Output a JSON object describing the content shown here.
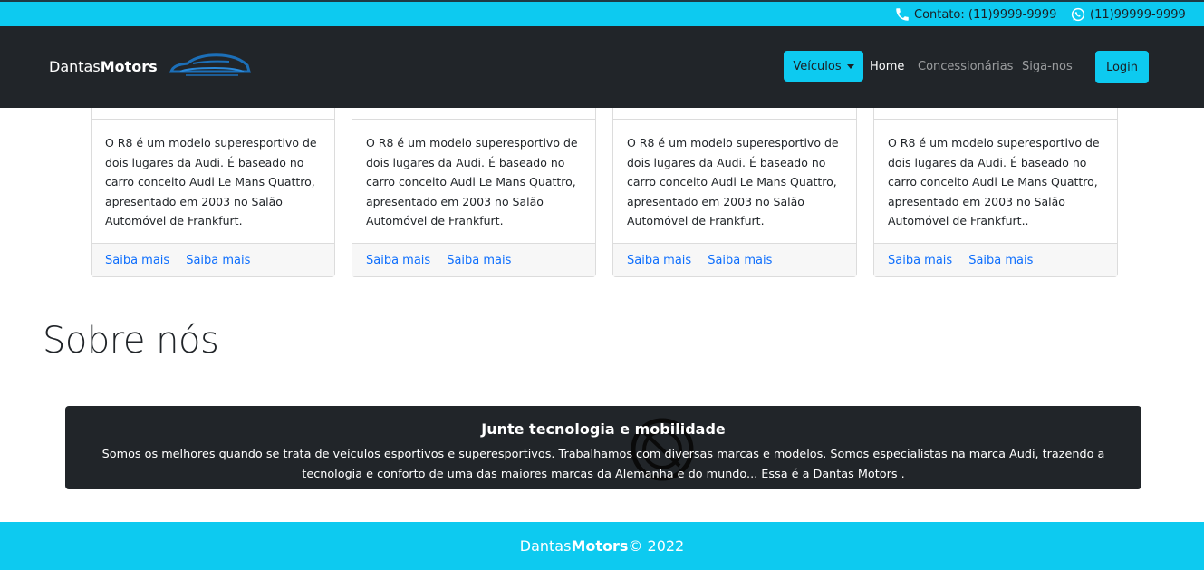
{
  "topbar": {
    "contact_label": "Contato: (11)9999-9999",
    "whatsapp_label": "(11)99999-9999"
  },
  "navbar": {
    "brand_light": "Dantas",
    "brand_bold": "Motors",
    "veiculos_label": "Veículos",
    "links": [
      "Home",
      "Concessionárias",
      "Siga-nos"
    ],
    "login_label": "Login"
  },
  "cards": [
    {
      "text": "O R8 é um modelo superesportivo de dois lugares da Audi. É baseado no carro conceito Audi Le Mans Quattro, apresentado em 2003 no Salão Automóvel de Frankfurt.",
      "link1": "Saiba mais",
      "link2": "Saiba mais"
    },
    {
      "text": "O R8 é um modelo superesportivo de dois lugares da Audi. É baseado no carro conceito Audi Le Mans Quattro, apresentado em 2003 no Salão Automóvel de Frankfurt.",
      "link1": "Saiba mais",
      "link2": "Saiba mais"
    },
    {
      "text": "O R8 é um modelo superesportivo de dois lugares da Audi. É baseado no carro conceito Audi Le Mans Quattro, apresentado em 2003 no Salão Automóvel de Frankfurt.",
      "link1": "Saiba mais",
      "link2": "Saiba mais"
    },
    {
      "text": "O R8 é um modelo superesportivo de dois lugares da Audi. É baseado no carro conceito Audi Le Mans Quattro, apresentado em 2003 no Salão Automóvel de Frankfurt..",
      "link1": "Saiba mais",
      "link2": "Saiba mais"
    }
  ],
  "sobre": {
    "title": "Sobre nós",
    "box_heading": "Junte tecnologia e mobilidade",
    "box_text": "Somos os melhores quando se trata de veículos esportivos e superesportivos. Trabalhamos com diversas marcas e modelos. Somos especialistas na marca Audi, trazendo a tecnologia e conforto de uma das maiores marcas da Alemanha e do mundo... Essa é a Dantas Motors ."
  },
  "footer": {
    "brand_light": "Dantas",
    "brand_bold": "Motors",
    "copyright": "© 2022"
  },
  "colors": {
    "accent": "#0dcaf0",
    "dark": "#212529",
    "link": "#0d6efd"
  },
  "icons": [
    "phone-icon",
    "whatsapp-icon",
    "car-logo-icon",
    "caret-down-icon",
    "watermark-logo-icon"
  ]
}
